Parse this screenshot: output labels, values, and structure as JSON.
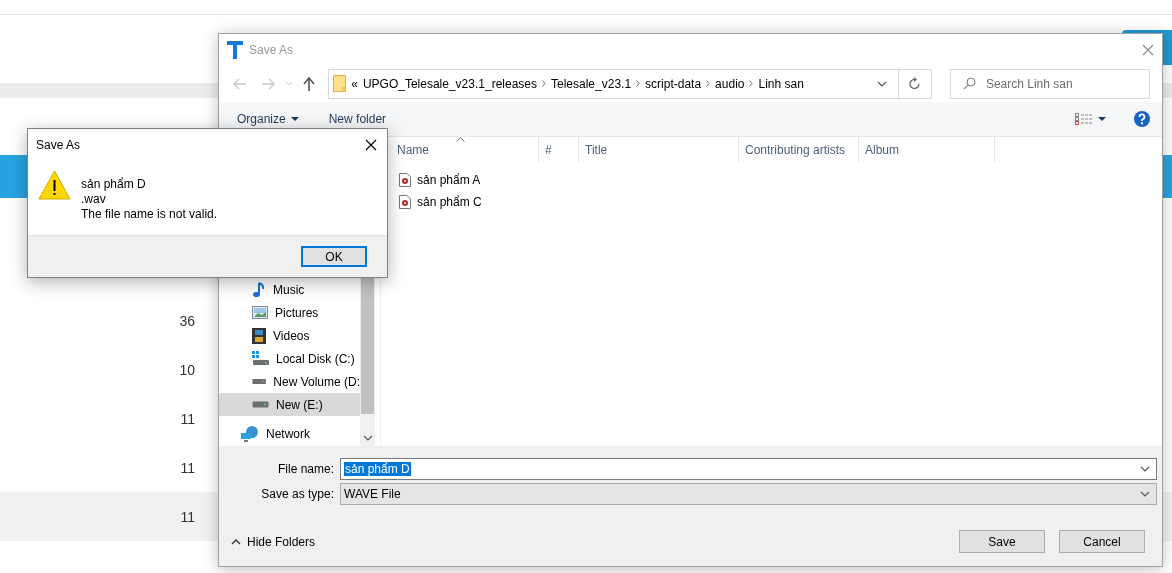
{
  "background_page": {
    "rows": [
      {
        "value": "36",
        "selected": false
      },
      {
        "value": "10",
        "selected": false
      },
      {
        "value": "11",
        "selected": false
      },
      {
        "value": "11",
        "selected": false
      },
      {
        "value": "11",
        "selected": true
      }
    ]
  },
  "save_dialog": {
    "title": "Save As",
    "address": {
      "overflow_mark": "«",
      "path": [
        "UPGO_Telesale_v23.1_releases",
        "Telesale_v23.1",
        "script-data",
        "audio",
        "Linh san"
      ]
    },
    "search": {
      "placeholder": "Search Linh san"
    },
    "toolbar": {
      "organize": "Organize",
      "new_folder": "New folder"
    },
    "columns": [
      {
        "label": "Name",
        "sorted": true
      },
      {
        "label": "#",
        "sorted": false
      },
      {
        "label": "Title",
        "sorted": false
      },
      {
        "label": "Contributing artists",
        "sorted": false
      },
      {
        "label": "Album",
        "sorted": false
      }
    ],
    "files": [
      {
        "name": "sản phẩm A",
        "selected": false
      },
      {
        "name": "sản phẩm C",
        "selected": false
      }
    ],
    "nav_items": [
      {
        "label": "Music",
        "kind": "music",
        "selected": false
      },
      {
        "label": "Pictures",
        "kind": "pictures",
        "selected": false
      },
      {
        "label": "Videos",
        "kind": "videos",
        "selected": false
      },
      {
        "label": "Local Disk (C:)",
        "kind": "system_drive",
        "selected": false
      },
      {
        "label": "New Volume (D:",
        "kind": "drive",
        "selected": false
      },
      {
        "label": "New (E:)",
        "kind": "drive",
        "selected": true
      },
      {
        "label": "Network",
        "kind": "network",
        "selected": false
      }
    ],
    "file_name": {
      "label": "File name:",
      "value": "sản phẩm D",
      "text_selected": true
    },
    "save_as_type": {
      "label": "Save as type:",
      "value": "WAVE File"
    },
    "hide_folders": "Hide Folders",
    "buttons": [
      "Save",
      "Cancel"
    ]
  },
  "alert": {
    "title": "Save As",
    "message_lines": [
      "sản phẩm D",
      ".wav",
      "The file name is not valid."
    ],
    "button": "OK"
  }
}
